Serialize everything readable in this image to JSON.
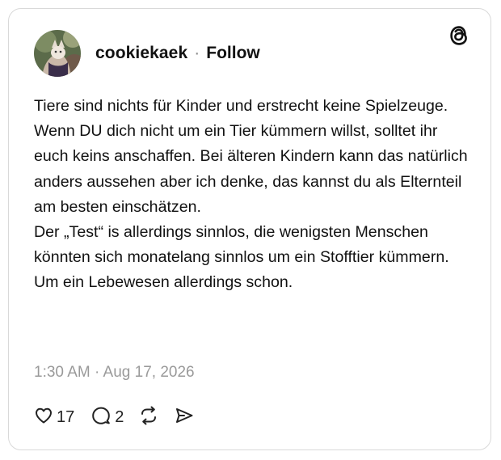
{
  "post": {
    "author": {
      "username": "cookiekaek",
      "separator": "·",
      "follow_label": "Follow",
      "avatar_icon": "avatar-photo"
    },
    "brand_icon": "threads-logo-icon",
    "text": "Tiere sind nichts für Kinder und erstrecht keine Spielzeuge. Wenn DU dich nicht um ein Tier kümmern willst, solltet ihr euch keins anschaffen. Bei älteren Kindern kann das natürlich anders aussehen aber ich denke, das kannst du als Elternteil am besten einschätzen.\nDer „Test“ is allerdings sinnlos, die wenigsten Menschen könnten sich monatelang sinnlos um ein Stofftier kümmern. Um ein Lebewesen allerdings schon.",
    "timestamp": "1:30 AM · Aug 17, 2026",
    "actions": {
      "like_count": "17",
      "reply_count": "2",
      "like_icon": "heart-icon",
      "reply_icon": "comment-icon",
      "repost_icon": "repost-icon",
      "share_icon": "send-icon"
    }
  },
  "colors": {
    "text": "#111111",
    "muted": "#9a9a9a",
    "border": "#d9d9d9"
  }
}
